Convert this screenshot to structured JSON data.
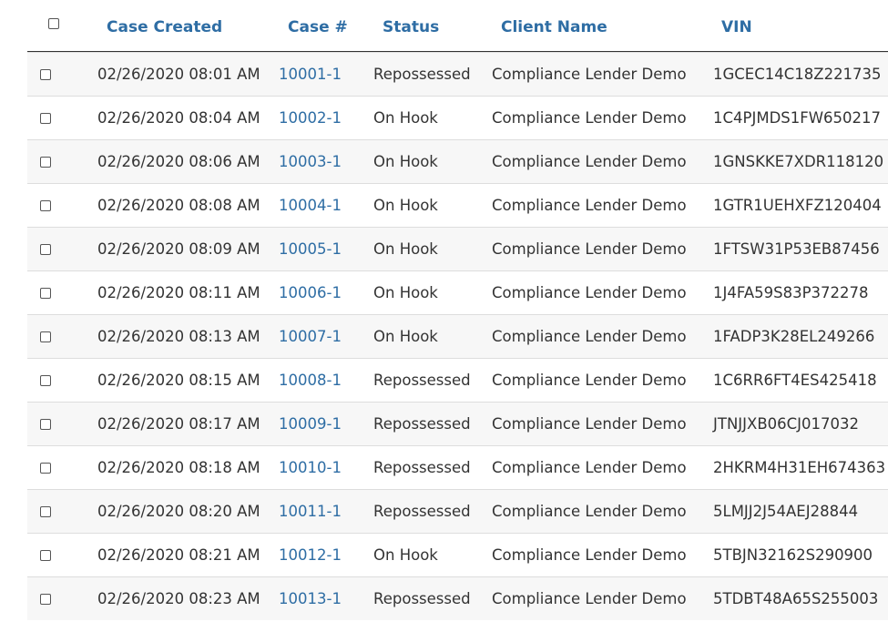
{
  "table": {
    "headers": {
      "case_created": "Case Created",
      "case_number": "Case #",
      "status": "Status",
      "client_name": "Client Name",
      "vin": "VIN"
    },
    "rows": [
      {
        "created": "02/26/2020 08:01 AM",
        "case": "10001-1",
        "status": "Repossessed",
        "client": "Compliance Lender Demo",
        "vin": "1GCEC14C18Z221735",
        "checked": false
      },
      {
        "created": "02/26/2020 08:04 AM",
        "case": "10002-1",
        "status": "On Hook",
        "client": "Compliance Lender Demo",
        "vin": "1C4PJMDS1FW650217",
        "checked": false
      },
      {
        "created": "02/26/2020 08:06 AM",
        "case": "10003-1",
        "status": "On Hook",
        "client": "Compliance Lender Demo",
        "vin": "1GNSKKE7XDR118120",
        "checked": false
      },
      {
        "created": "02/26/2020 08:08 AM",
        "case": "10004-1",
        "status": "On Hook",
        "client": "Compliance Lender Demo",
        "vin": "1GTR1UEHXFZ120404",
        "checked": false
      },
      {
        "created": "02/26/2020 08:09 AM",
        "case": "10005-1",
        "status": "On Hook",
        "client": "Compliance Lender Demo",
        "vin": "1FTSW31P53EB87456",
        "checked": false
      },
      {
        "created": "02/26/2020 08:11 AM",
        "case": "10006-1",
        "status": "On Hook",
        "client": "Compliance Lender Demo",
        "vin": "1J4FA59S83P372278",
        "checked": false
      },
      {
        "created": "02/26/2020 08:13 AM",
        "case": "10007-1",
        "status": "On Hook",
        "client": "Compliance Lender Demo",
        "vin": "1FADP3K28EL249266",
        "checked": false
      },
      {
        "created": "02/26/2020 08:15 AM",
        "case": "10008-1",
        "status": "Repossessed",
        "client": "Compliance Lender Demo",
        "vin": "1C6RR6FT4ES425418",
        "checked": false
      },
      {
        "created": "02/26/2020 08:17 AM",
        "case": "10009-1",
        "status": "Repossessed",
        "client": "Compliance Lender Demo",
        "vin": "JTNJJXB06CJ017032",
        "checked": false
      },
      {
        "created": "02/26/2020 08:18 AM",
        "case": "10010-1",
        "status": "Repossessed",
        "client": "Compliance Lender Demo",
        "vin": "2HKRM4H31EH674363",
        "checked": false
      },
      {
        "created": "02/26/2020 08:20 AM",
        "case": "10011-1",
        "status": "Repossessed",
        "client": "Compliance Lender Demo",
        "vin": "5LMJJ2J54AEJ28844",
        "checked": false
      },
      {
        "created": "02/26/2020 08:21 AM",
        "case": "10012-1",
        "status": "On Hook",
        "client": "Compliance Lender Demo",
        "vin": "5TBJN32162S290900",
        "checked": false
      },
      {
        "created": "02/26/2020 08:23 AM",
        "case": "10013-1",
        "status": "Repossessed",
        "client": "Compliance Lender Demo",
        "vin": "5TDBT48A65S255003",
        "checked": false
      }
    ]
  },
  "colors": {
    "header_text": "#2e6da4",
    "link": "#2e6da4",
    "body_text": "#333333",
    "odd_row_bg": "#f7f7f7",
    "even_row_bg": "#ffffff",
    "row_border": "#dddddd",
    "header_border": "#333333"
  }
}
